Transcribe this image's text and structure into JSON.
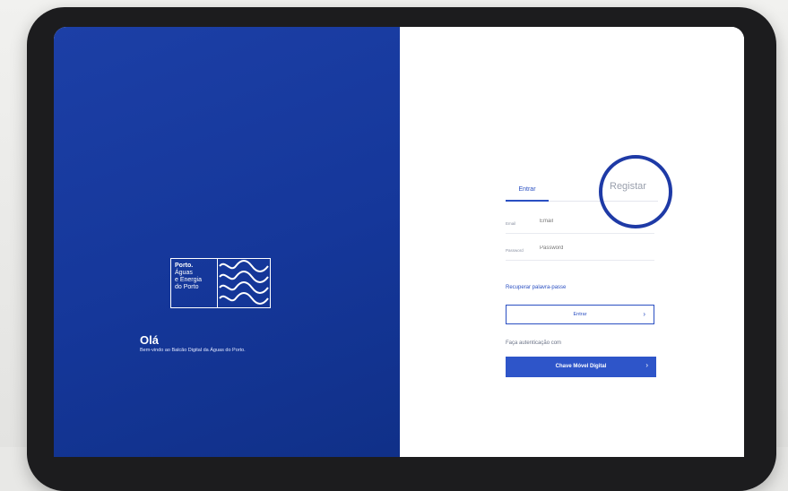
{
  "left": {
    "logo": {
      "line1": "Porto.",
      "line2": "Águas",
      "line3": "e Energia",
      "line4": "do Porto"
    },
    "greeting": "Olá",
    "welcome": "Bem-vindo ao Balcão Digital da Águas do Porto."
  },
  "tabs": {
    "login": "Entrar",
    "register": "Registar"
  },
  "form": {
    "email_label": "Email",
    "email_placeholder": "Email",
    "password_label": "Password",
    "password_placeholder": "Password",
    "recover_link": "Recuperar palavra-passe",
    "enter_button": "Entrar",
    "auth_text": "Faça autenticação com",
    "cmd_button": "Chave Móvel Digital",
    "chevron": "›"
  },
  "colors": {
    "brand_blue": "#15379a",
    "accent_blue": "#2a4fc2",
    "highlight_circle": "#1e3aa6"
  }
}
